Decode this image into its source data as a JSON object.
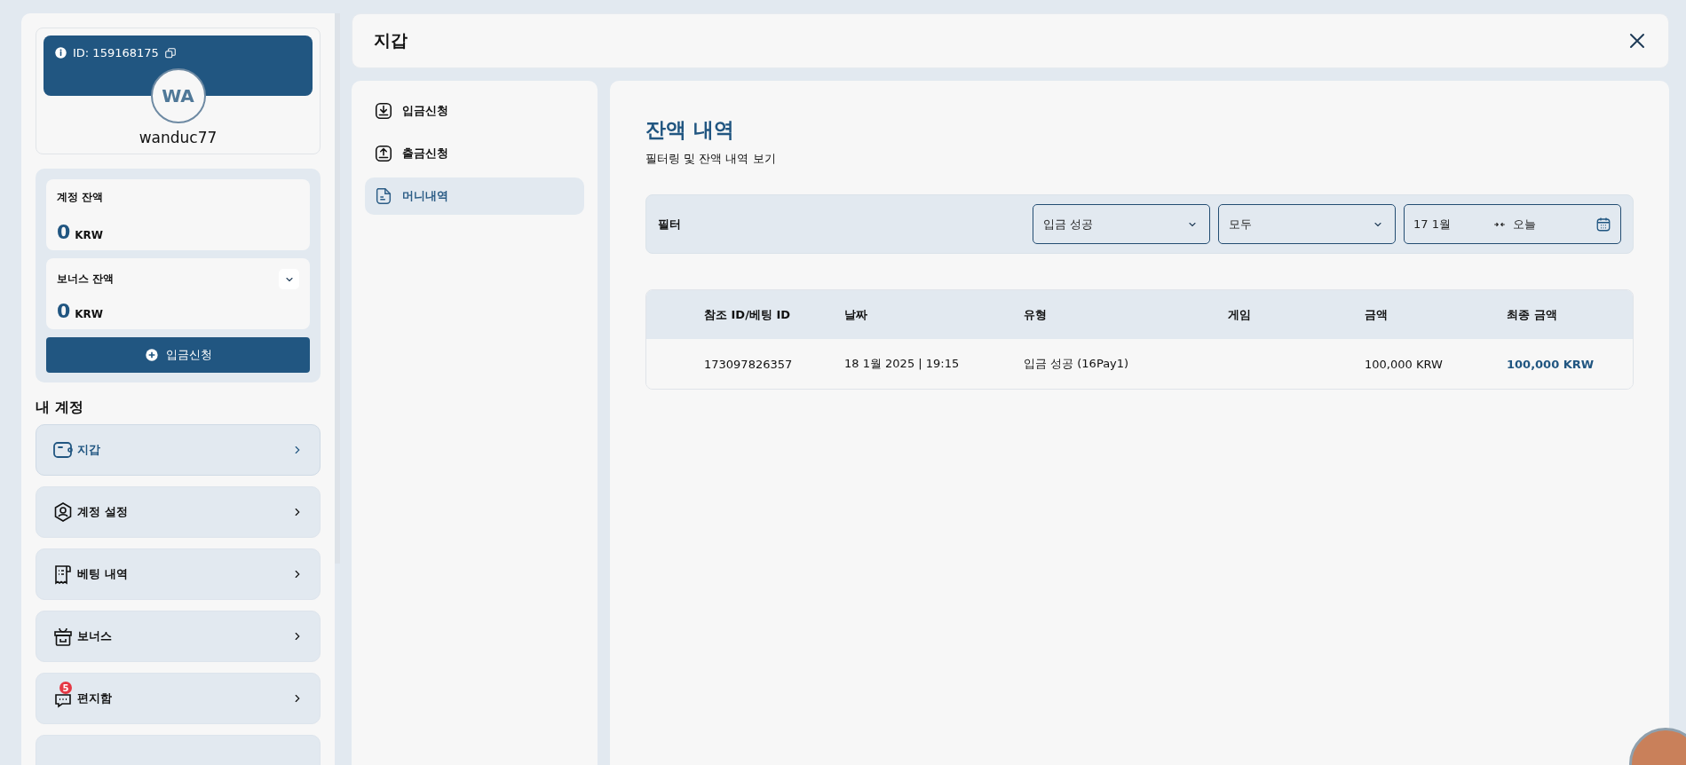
{
  "header": {
    "title": "지갑"
  },
  "profile": {
    "id_label": "ID: 159168175",
    "initials": "WA",
    "username": "wanduc77"
  },
  "balances": [
    {
      "label": "계정 잔액",
      "amount": "0",
      "currency": "KRW",
      "expandable": false
    },
    {
      "label": "보너스 잔액",
      "amount": "0",
      "currency": "KRW",
      "expandable": true
    }
  ],
  "deposit_button": {
    "label": "입금신청"
  },
  "account_menu": {
    "title": "내 계정",
    "items": [
      {
        "label": "지갑",
        "selected": true
      },
      {
        "label": "계정 설정",
        "selected": false
      },
      {
        "label": "베팅 내역",
        "selected": false
      },
      {
        "label": "보너스",
        "selected": false
      },
      {
        "label": "편지함",
        "badge": "5",
        "selected": false
      },
      {
        "selected": false
      }
    ]
  },
  "wallet_menu": [
    {
      "label": "입금신청",
      "selected": false
    },
    {
      "label": "출금신청",
      "selected": false
    },
    {
      "label": "머니내역",
      "selected": true
    }
  ],
  "content": {
    "title": "잔액 내역",
    "subtitle": "필터링 및 잔액 내역 보기",
    "filter": {
      "label": "필터",
      "type_select": "입금 성공",
      "status_select": "모두",
      "date_from": "17 1월",
      "date_to": "오늘"
    },
    "table": {
      "columns": [
        "참조 ID/베팅 ID",
        "날짜",
        "유형",
        "게임",
        "금액",
        "최종 금액"
      ],
      "rows": [
        [
          "173097826357",
          "18 1월 2025 | 19:15",
          "입금 성공 (16Pay1)",
          "",
          "100,000 KRW",
          "100,000 KRW"
        ]
      ]
    }
  }
}
